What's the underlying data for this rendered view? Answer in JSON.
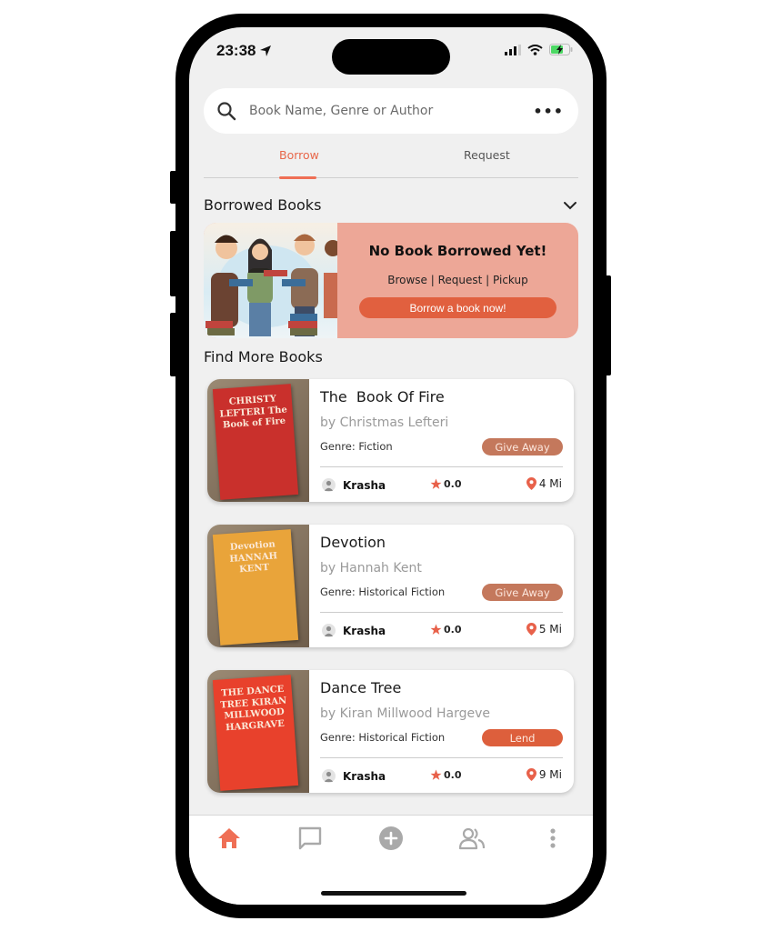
{
  "status_bar": {
    "time": "23:38"
  },
  "search": {
    "placeholder": "Book Name, Genre or Author",
    "value": ""
  },
  "tabs": [
    {
      "label": "Borrow",
      "active": true
    },
    {
      "label": "Request",
      "active": false
    }
  ],
  "borrowed_section": {
    "title": "Borrowed Books",
    "empty_title": "No Book Borrowed Yet!",
    "empty_subtitle": "Browse | Request | Pickup",
    "cta_label": "Borrow a book now!"
  },
  "find_section": {
    "title": "Find More Books"
  },
  "books": [
    {
      "title": "The  Book Of Fire",
      "author": "by Christmas Lefteri",
      "genre": "Genre: Fiction",
      "badge": "Give Away",
      "badge_color": "#c4785c",
      "owner": "Krasha",
      "rating": "0.0",
      "distance": "4 Mi",
      "cover_color": "#c9302c",
      "cover_text": "CHRISTY LEFTERI The Book of Fire"
    },
    {
      "title": "Devotion",
      "author": "by Hannah Kent",
      "genre": "Genre: Historical Fiction",
      "badge": "Give Away",
      "badge_color": "#c4785c",
      "owner": "Krasha",
      "rating": "0.0",
      "distance": "5 Mi",
      "cover_color": "#e9a43a",
      "cover_text": "Devotion HANNAH KENT"
    },
    {
      "title": "Dance Tree",
      "author": "by Kiran Millwood Hargeve",
      "genre": "Genre: Historical Fiction",
      "badge": "Lend",
      "badge_color": "#dd5f3c",
      "owner": "Krasha",
      "rating": "0.0",
      "distance": "9 Mi",
      "cover_color": "#e8412c",
      "cover_text": "THE DANCE TREE KIRAN MILLWOOD HARGRAVE"
    }
  ],
  "bottom_nav": [
    {
      "icon": "home-icon",
      "active": true
    },
    {
      "icon": "chat-icon",
      "active": false
    },
    {
      "icon": "add-circle-icon",
      "active": false
    },
    {
      "icon": "people-icon",
      "active": false
    },
    {
      "icon": "more-vertical-icon",
      "active": false
    }
  ],
  "colors": {
    "accent": "#ef6f55",
    "cta": "#e1603f",
    "empty_card_bg": "#eda797",
    "inactive_icon": "#a9a9a9"
  }
}
